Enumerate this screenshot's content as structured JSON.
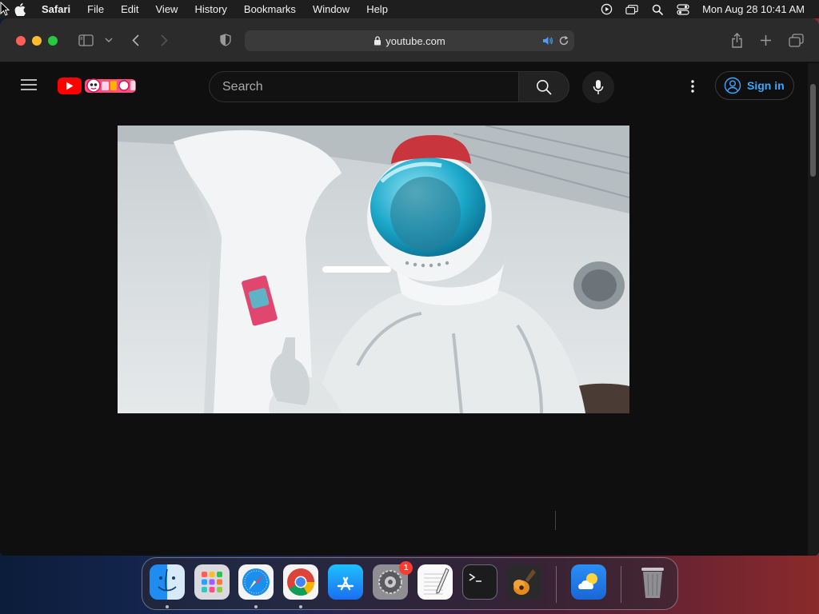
{
  "menubar": {
    "app_name": "Safari",
    "items": [
      "File",
      "Edit",
      "View",
      "History",
      "Bookmarks",
      "Window",
      "Help"
    ],
    "clock": "Mon Aug 28  10:41 AM"
  },
  "browser": {
    "url": "youtube.com"
  },
  "youtube": {
    "search_placeholder": "Search",
    "signin_label": "Sign in",
    "brand_red": "#ff0000",
    "link_blue": "#3ea6ff"
  },
  "dock": {
    "apps": [
      "Finder",
      "Launchpad",
      "Safari",
      "Google Chrome",
      "App Store",
      "System Settings",
      "TextEdit",
      "Terminal",
      "GarageBand",
      "Weather",
      "Trash"
    ],
    "settings_badge": "1"
  }
}
